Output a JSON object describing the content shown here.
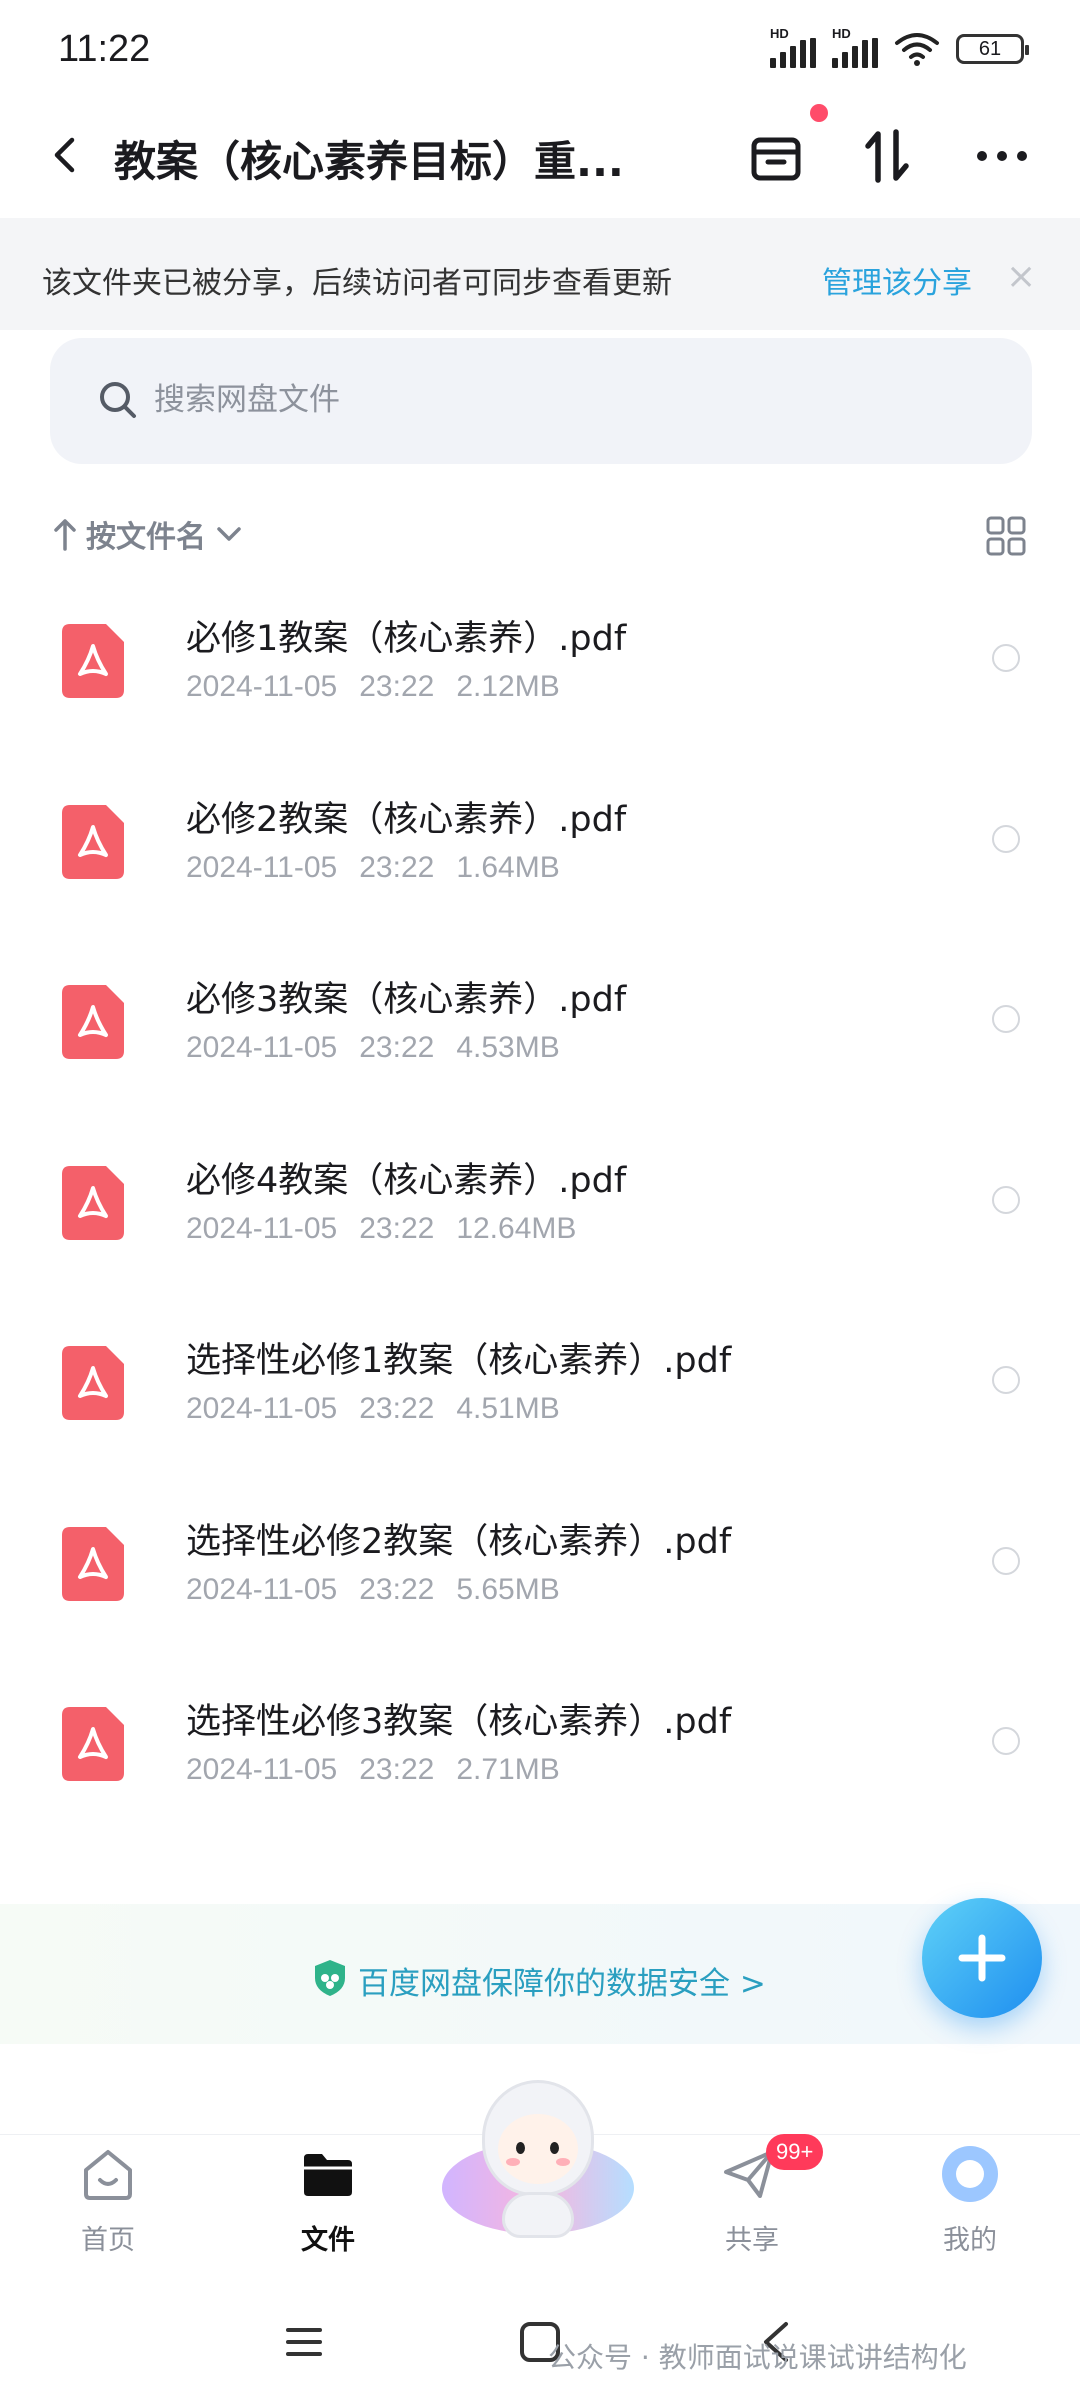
{
  "status_bar": {
    "time": "11:22",
    "battery": "61",
    "hd1": "HD",
    "hd2": "HD"
  },
  "header": {
    "title": "教案（核心素养目标）重..."
  },
  "share_banner": {
    "text": "该文件夹已被分享，后续访问者可同步查看更新",
    "link": "管理该分享",
    "close": "×"
  },
  "search": {
    "placeholder": "搜索网盘文件"
  },
  "sort": {
    "label": "按文件名"
  },
  "files": [
    {
      "name": "必修1教案（核心素养）.pdf",
      "date": "2024-11-05",
      "time": "23:22",
      "size": "2.12MB"
    },
    {
      "name": "必修2教案（核心素养）.pdf",
      "date": "2024-11-05",
      "time": "23:22",
      "size": "1.64MB"
    },
    {
      "name": "必修3教案（核心素养）.pdf",
      "date": "2024-11-05",
      "time": "23:22",
      "size": "4.53MB"
    },
    {
      "name": "必修4教案（核心素养）.pdf",
      "date": "2024-11-05",
      "time": "23:22",
      "size": "12.64MB"
    },
    {
      "name": "选择性必修1教案（核心素养）.pdf",
      "date": "2024-11-05",
      "time": "23:22",
      "size": "4.51MB"
    },
    {
      "name": "选择性必修2教案（核心素养）.pdf",
      "date": "2024-11-05",
      "time": "23:22",
      "size": "5.65MB"
    },
    {
      "name": "选择性必修3教案（核心素养）.pdf",
      "date": "2024-11-05",
      "time": "23:22",
      "size": "2.71MB"
    }
  ],
  "safety": {
    "text": "百度网盘保障你的数据安全 >"
  },
  "nav": {
    "home": "首页",
    "files": "文件",
    "share": "共享",
    "share_badge": "99+",
    "me": "我的"
  },
  "watermark": "公众号 · 教师面试说课试讲结构化",
  "colors": {
    "accent": "#2aa3dd",
    "pdf_red": "#f4606a",
    "badge": "#ff3a5a"
  }
}
